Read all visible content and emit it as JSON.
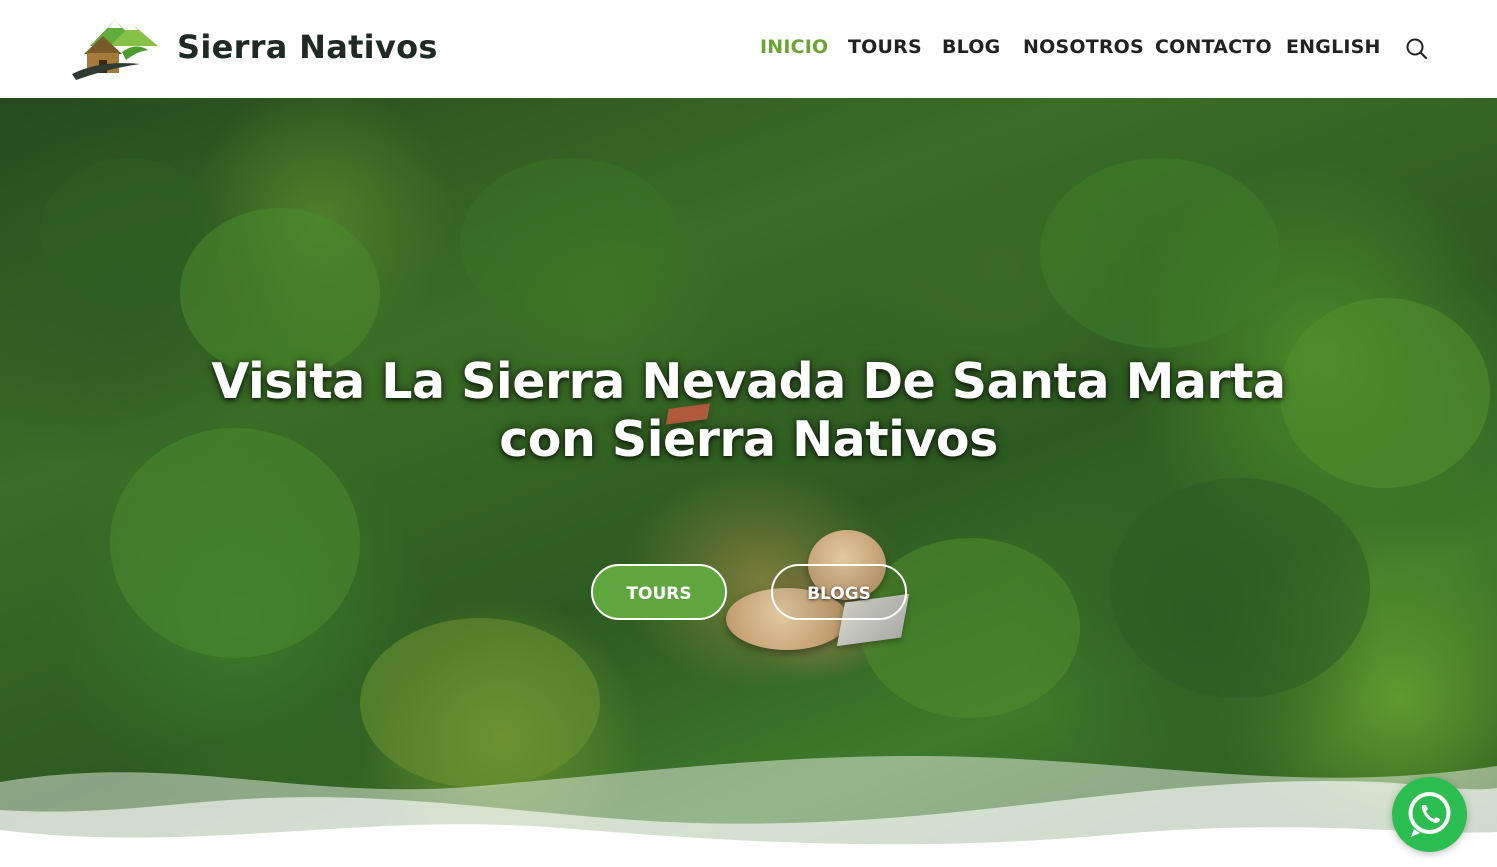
{
  "brand": {
    "name": "Sierra Nativos",
    "logo_icon": "hut-mountain-logo"
  },
  "nav": {
    "items": [
      {
        "label": "INICIO",
        "active": true
      },
      {
        "label": "TOURS",
        "active": false
      },
      {
        "label": "BLOG",
        "active": false
      },
      {
        "label": "NOSOTROS",
        "active": false
      },
      {
        "label": "CONTACTO",
        "active": false
      },
      {
        "label": "ENGLISH",
        "active": false
      }
    ],
    "search_icon": "search-icon"
  },
  "hero": {
    "title_line1": "Visita La Sierra Nevada De Santa Marta",
    "title_line2": "con Sierra Nativos",
    "buttons": {
      "tours": "TOURS",
      "blogs": "BLOGS"
    },
    "background": "aerial jungle with thatched huts"
  },
  "floating": {
    "whatsapp_icon": "whatsapp-icon"
  },
  "colors": {
    "accent": "#6aa534",
    "button_green": "#5fa63e",
    "whatsapp": "#2bbd4f",
    "text_dark": "#222222"
  }
}
